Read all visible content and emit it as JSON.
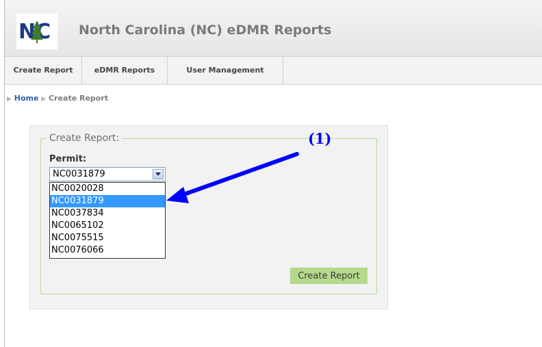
{
  "header": {
    "logo_text": "NC",
    "app_title": "North Carolina (NC) eDMR Reports"
  },
  "nav": {
    "tabs": [
      {
        "label": "Create Report"
      },
      {
        "label": "eDMR Reports"
      },
      {
        "label": "User Management"
      }
    ]
  },
  "breadcrumb": {
    "home": "Home",
    "current": "Create Report"
  },
  "form": {
    "legend": "Create Report:",
    "permit_label": "Permit:",
    "selected_permit": "NC0031879",
    "options": [
      "NC0020028",
      "NC0031879",
      "NC0037834",
      "NC0065102",
      "NC0075515",
      "NC0076066"
    ],
    "highlighted_index": 1,
    "submit_label": "Create Report"
  },
  "annotation": {
    "label": "(1)",
    "color": "#0000ff"
  },
  "colors": {
    "logo_blue": "#1d3a8a",
    "logo_green": "#3f7d2a",
    "fieldset_border": "#b9dc97",
    "button_bg": "#b5d98b",
    "selection": "#3399ff"
  }
}
